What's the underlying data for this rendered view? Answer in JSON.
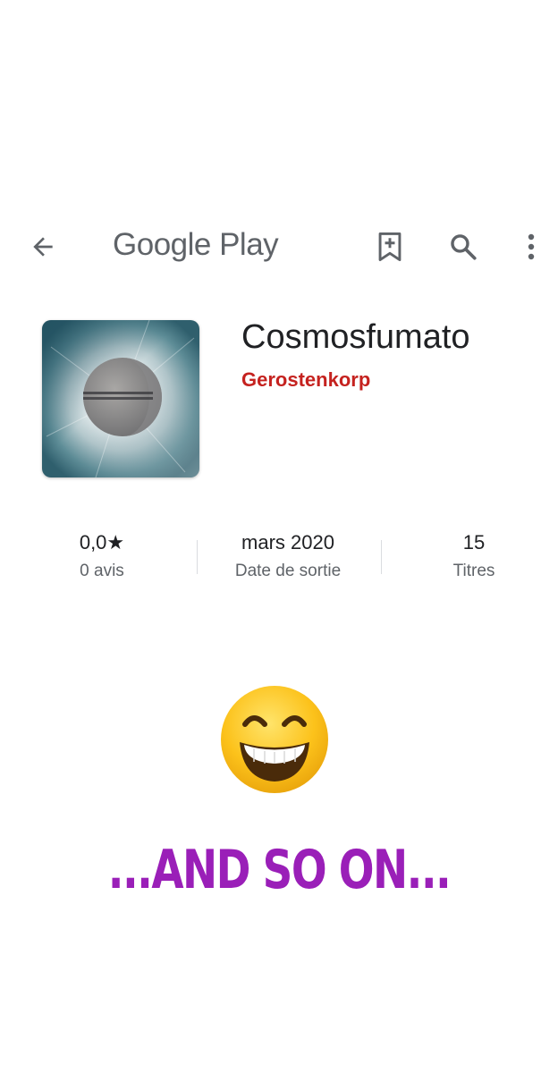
{
  "appbar": {
    "brand": "Google Play",
    "icons": {
      "back": "arrow-back-icon",
      "wishlist": "bookmark-add-icon",
      "search": "search-icon",
      "more": "more-vert-icon"
    },
    "icon_color": "#5f6368"
  },
  "album": {
    "title": "Cosmosfumato",
    "artist": "Gerostenkorp",
    "artist_color": "#c5221f",
    "cover_icon": "album-cover-eclipse"
  },
  "stats": {
    "rating_value": "0,0",
    "rating_label": "0 avis",
    "release_value": "mars 2020",
    "release_label": "Date de sortie",
    "tracks_value": "15",
    "tracks_label": "Titres"
  },
  "emoji": {
    "icon": "grinning-face-with-smiling-eyes-emoji"
  },
  "caption": {
    "text": "...AND SO ON...",
    "color": "#9a1fb8"
  }
}
